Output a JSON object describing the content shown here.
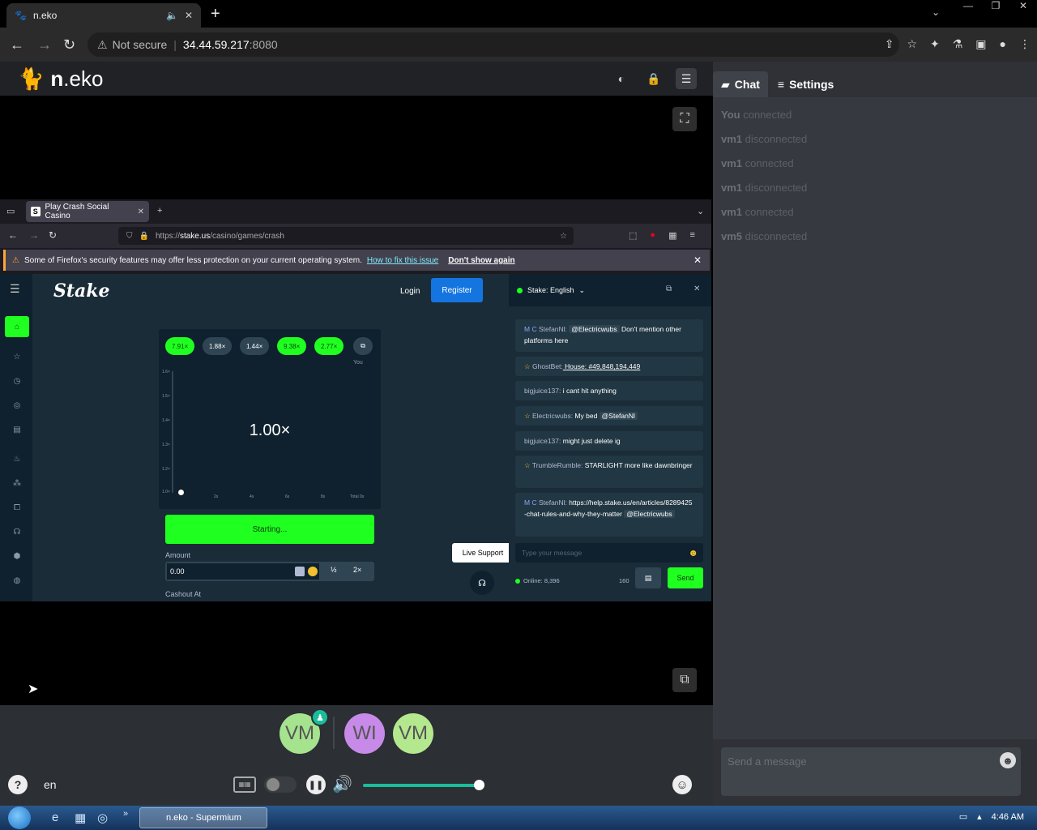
{
  "browser": {
    "tab_title": "n.eko",
    "not_secure": "Not secure",
    "url_host": "34.44.59.217",
    "url_port": ":8080"
  },
  "neko": {
    "logo_n": "n",
    "logo_rest": ".eko",
    "lang": "en",
    "side_tabs": [
      {
        "label": "Chat"
      },
      {
        "label": "Settings"
      }
    ],
    "log": [
      {
        "user": "You",
        "action": "connected"
      },
      {
        "user": "vm1",
        "action": "disconnected"
      },
      {
        "user": "vm1",
        "action": "connected"
      },
      {
        "user": "vm1",
        "action": "disconnected"
      },
      {
        "user": "vm1",
        "action": "connected"
      },
      {
        "user": "vm5",
        "action": "disconnected"
      }
    ],
    "chat_placeholder": "Send a message",
    "members": [
      {
        "initials": "VM",
        "color": "#a5e38f"
      },
      {
        "initials": "WI",
        "color": "#c88ae8"
      },
      {
        "initials": "VM",
        "color": "#b4e88e"
      }
    ],
    "volume_percent": 100
  },
  "firefox": {
    "tab_title": "Play Crash Social Casino",
    "tab_favicon": "S",
    "url_scheme": "https://",
    "url_host": "stake.us",
    "url_path": "/casino/games/crash",
    "notice_text": "Some of Firefox's security features may offer less protection on your current operating system.",
    "notice_link": "How to fix this issue",
    "notice_button": "Don't show again"
  },
  "stake": {
    "logo": "Stake",
    "login": "Login",
    "register": "Register",
    "history": [
      "7.91×",
      "1.88×",
      "1.44×",
      "9.38×",
      "2.77×"
    ],
    "you_label": "You",
    "y_labels": [
      "1.6×",
      "1.5×",
      "1.4×",
      "1.3×",
      "1.2×",
      "1.0×"
    ],
    "x_labels": [
      "2s",
      "4s",
      "6s",
      "8s",
      "Total 0s"
    ],
    "multiplier": "1.00×",
    "starting": "Starting...",
    "amount_label": "Amount",
    "amount_value": "0.00",
    "half": "½",
    "double": "2×",
    "cashout_label": "Cashout At",
    "live_support": "Live Support",
    "chat": {
      "header": "Stake: English",
      "messages": [
        {
          "pre": "M C ",
          "user": "StefanNl:",
          "tag": "@Electricwubs",
          "text": " Don't mention other platforms here"
        },
        {
          "pre": "☆ ",
          "user": "GhostBet:",
          "text": " House: #49,848,194,449"
        },
        {
          "pre": "",
          "user": "bigjuice137:",
          "text": " i cant hit anything"
        },
        {
          "pre": "☆ ",
          "user": "Electricwubs:",
          "text": " My bed ",
          "tag": "@StefanNl"
        },
        {
          "pre": "",
          "user": "bigjuice137:",
          "text": " might just delete ig"
        },
        {
          "pre": "☆ ",
          "user": "TrumbleRumble:",
          "text": " STARLIGHT more like dawnbringer"
        },
        {
          "pre": "M C ",
          "user": "StefanNl:",
          "text": " https://help.stake.us/en/articles/8289425-chat-rules-and-why-they-matter ",
          "tag": "@Electricwubs"
        }
      ],
      "input_placeholder": "Type your message",
      "online": "Online: 8,396",
      "char_count": "160",
      "send": "Send"
    }
  },
  "taskbar": {
    "task_label": "n.eko - Supermium",
    "time": "4:46 AM"
  }
}
